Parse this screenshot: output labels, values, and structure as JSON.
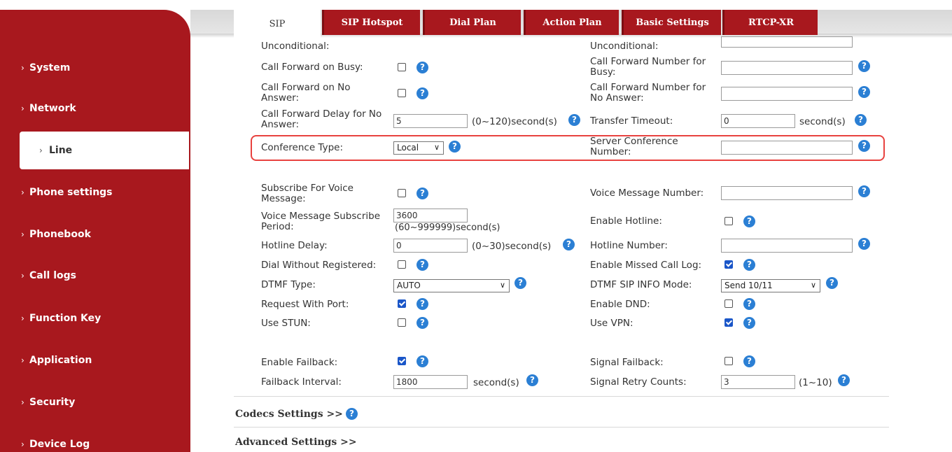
{
  "tabs": [
    "SIP",
    "SIP Hotspot",
    "Dial Plan",
    "Action Plan",
    "Basic Settings",
    "RTCP-XR"
  ],
  "sidebar": {
    "items": [
      {
        "label": "System"
      },
      {
        "label": "Network"
      },
      {
        "label": "Line"
      },
      {
        "label": "Phone settings"
      },
      {
        "label": "Phonebook"
      },
      {
        "label": "Call logs"
      },
      {
        "label": "Function Key"
      },
      {
        "label": "Application"
      },
      {
        "label": "Security"
      },
      {
        "label": "Device Log"
      }
    ],
    "chevron": "›",
    "active": "Line"
  },
  "form": {
    "unconditional_left": "Unconditional:",
    "unconditional_right": "Unconditional:",
    "cf_busy_label": "Call Forward on Busy:",
    "cf_busy_checked": false,
    "cf_busy_number_label": "Call Forward Number for Busy:",
    "cf_busy_number": "",
    "cf_noanswer_label": "Call Forward on No Answer:",
    "cf_noanswer_checked": false,
    "cf_noanswer_number_label": "Call Forward Number for No Answer:",
    "cf_noanswer_number": "",
    "cf_delay_label": "Call Forward Delay for No Answer:",
    "cf_delay_value": "5",
    "cf_delay_unit": "(0~120)second(s)",
    "transfer_timeout_label": "Transfer Timeout:",
    "transfer_timeout_value": "0",
    "transfer_timeout_unit": "second(s)",
    "conference_type_label": "Conference Type:",
    "conference_type_value": "Local",
    "server_conf_label": "Server Conference Number:",
    "server_conf_value": "",
    "subscribe_vm_label": "Subscribe For Voice Message:",
    "subscribe_vm_checked": false,
    "vm_number_label": "Voice Message Number:",
    "vm_number_value": "",
    "vm_period_label": "Voice Message Subscribe Period:",
    "vm_period_value": "3600",
    "vm_period_unit": "(60~999999)second(s)",
    "enable_hotline_label": "Enable Hotline:",
    "enable_hotline_checked": false,
    "hotline_delay_label": "Hotline Delay:",
    "hotline_delay_value": "0",
    "hotline_delay_unit": "(0~30)second(s)",
    "hotline_number_label": "Hotline Number:",
    "hotline_number_value": "",
    "dial_wo_reg_label": "Dial Without Registered:",
    "dial_wo_reg_checked": false,
    "missed_log_label": "Enable Missed Call Log:",
    "missed_log_checked": true,
    "dtmf_type_label": "DTMF Type:",
    "dtmf_type_value": "AUTO",
    "dtmf_sip_label": "DTMF SIP INFO Mode:",
    "dtmf_sip_value": "Send 10/11",
    "request_port_label": "Request With Port:",
    "request_port_checked": true,
    "dnd_label": "Enable DND:",
    "dnd_checked": false,
    "stun_label": "Use STUN:",
    "stun_checked": false,
    "vpn_label": "Use VPN:",
    "vpn_checked": true,
    "failback_label": "Enable Failback:",
    "failback_checked": true,
    "signal_failback_label": "Signal Failback:",
    "signal_failback_checked": false,
    "failback_interval_label": "Failback Interval:",
    "failback_interval_value": "1800",
    "failback_interval_unit": "second(s)",
    "retry_label": "Signal Retry Counts:",
    "retry_value": "3",
    "retry_unit": "(1~10)"
  },
  "sections": {
    "codecs": "Codecs Settings >>",
    "advanced": "Advanced Settings >>"
  },
  "icons": {
    "help": "?"
  },
  "colors": {
    "brand_red": "#a8181e",
    "help_blue": "#2b7fd4",
    "checkbox_blue": "#1a56c8",
    "highlight_red": "#e8423f"
  }
}
